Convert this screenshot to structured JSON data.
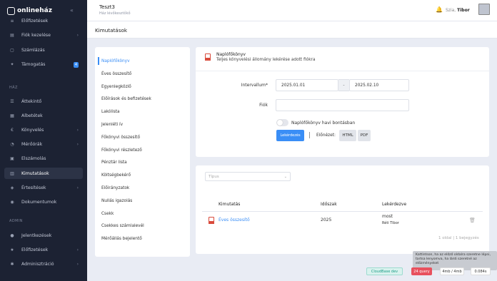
{
  "brand": {
    "name": "onlineház"
  },
  "sidebar": {
    "items_top": [
      {
        "label": "Előfizetések",
        "icon": "layers-icon",
        "chevron": false
      },
      {
        "label": "Fiók kezelése",
        "icon": "folder-icon",
        "chevron": true
      },
      {
        "label": "Számlázás",
        "icon": "receipt-icon",
        "chevron": false
      },
      {
        "label": "Támogatás",
        "icon": "lightbulb-icon",
        "chevron": false,
        "badge": "4"
      }
    ],
    "section_haz": "HÁZ",
    "items_haz": [
      {
        "label": "Áttekintő",
        "icon": "list-icon",
        "chevron": false
      },
      {
        "label": "Albetétek",
        "icon": "grid-icon",
        "chevron": false
      },
      {
        "label": "Könyvelés",
        "icon": "euro-icon",
        "chevron": true
      },
      {
        "label": "Mérőórák",
        "icon": "gauge-icon",
        "chevron": true
      },
      {
        "label": "Elszámolás",
        "icon": "calculator-icon",
        "chevron": false
      },
      {
        "label": "Kimutatások",
        "icon": "bar-chart-icon",
        "chevron": false,
        "active": true
      },
      {
        "label": "Értesítések",
        "icon": "bell-icon",
        "chevron": true
      },
      {
        "label": "Dokumentumok",
        "icon": "globe-icon",
        "chevron": false
      }
    ],
    "section_admin": "ADMIN",
    "items_admin": [
      {
        "label": "Jelentkezések",
        "icon": "user-icon",
        "chevron": false
      },
      {
        "label": "Előfizetések",
        "icon": "star-icon",
        "chevron": true
      },
      {
        "label": "Adminisztráció",
        "icon": "gear-icon",
        "chevron": true
      }
    ]
  },
  "topbar": {
    "company": "Teszt3",
    "company_sub": "Ház lévőkesztőkő",
    "greeting": "Szia,",
    "user": "Tibor"
  },
  "page": {
    "title": "Kimutatások"
  },
  "reports": [
    "Naplófőkönyv",
    "Éves összesítő",
    "Egyenlegközlő",
    "Előírások és befizetések",
    "Lakólista",
    "Jelenléti ív",
    "Főkönyvi összesítő",
    "Főkönyvi részletező",
    "Pénztár lista",
    "Költségbekérő",
    "Előirányzatok",
    "Nullás igazolás",
    "Csekk",
    "Csekkes számlalevél",
    "Mérőállás bejelentő"
  ],
  "form": {
    "title": "Naplófőkönyv",
    "subtitle": "Teljes könyvelési állomány lekérése adott fiókra",
    "interval_label": "Intervallum*",
    "date_from": "2025.01.01",
    "date_sep": "-",
    "date_to": "2025.02.10",
    "account_label": "Fiók",
    "account_value": "",
    "toggle_label": "Naplófőkönyv havi bontásban",
    "submit": "Lekérdezés",
    "preview_label": "Előnézet:",
    "html_btn": "HTML",
    "pdf_btn": "PDF"
  },
  "results": {
    "filter_placeholder": "Típus",
    "columns": {
      "report": "Kimutatás",
      "period": "Időszak",
      "requested": "Lekérdezve"
    },
    "rows": [
      {
        "report": "Éves összesítő",
        "period": "2025",
        "requested": "most",
        "by": "Réti Tibor"
      }
    ],
    "pager": "1 oldal | 1 bejegyzés"
  },
  "debug": {
    "tooltip": "Kattintson, ha az előző oldalra szeretne lépni, tartsa lenyomva, ha lánti szeretné az előzményeket",
    "env": "CloudBase dev",
    "queries": "24 query",
    "memory": "4mb / 4mb",
    "time": "0.084s"
  }
}
